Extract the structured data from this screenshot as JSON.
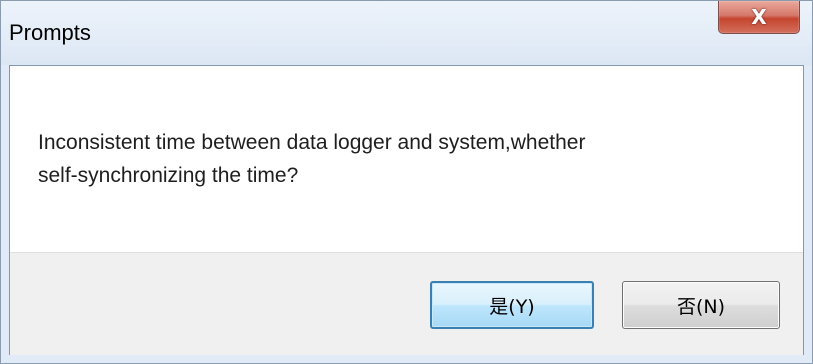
{
  "window": {
    "title": "Prompts"
  },
  "titlebar": {
    "close_icon": "close-icon",
    "close_glyph": "X"
  },
  "dialog": {
    "message_line1": "Inconsistent time between data logger and system,whether",
    "message_line2": "self-synchronizing the time?",
    "yes_label": "是(Y)",
    "no_label": "否(N)"
  },
  "colors": {
    "titlebar": "#dce7f4",
    "close_button": "#c5452e",
    "button_area": "#f0f0f0",
    "default_button_border": "#3c7fb1"
  }
}
